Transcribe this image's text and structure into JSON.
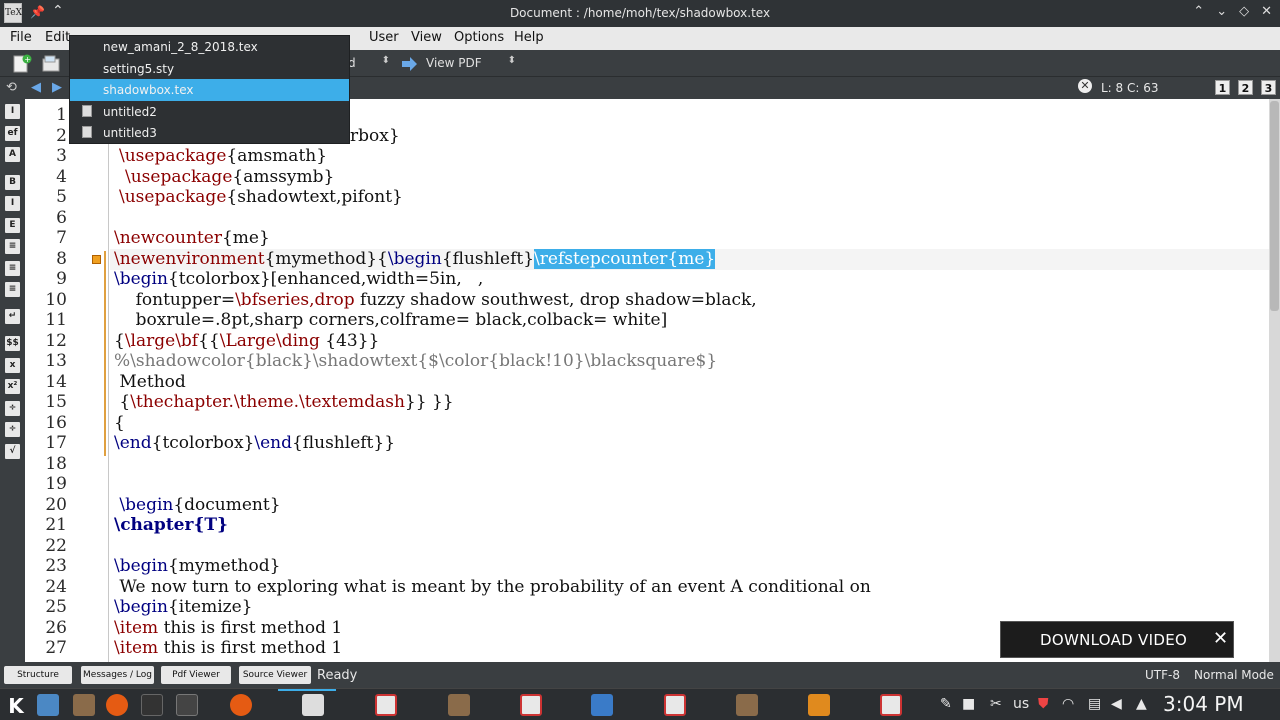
{
  "window": {
    "title": "Document : /home/moh/tex/shadowbox.tex",
    "app_icon": "TeX"
  },
  "menu": [
    "File",
    "Edit",
    "User",
    "View",
    "Options",
    "Help"
  ],
  "toolbar": {
    "combo1": "d",
    "combo2": "View PDF"
  },
  "editor_header": {
    "cursor": "L: 8 C: 63",
    "panes": [
      "1",
      "2",
      "3"
    ]
  },
  "dropdown": [
    "new_amani_2_8_2018.tex",
    "setting5.sty",
    "shadowbox.tex",
    "untitled2",
    "untitled3"
  ],
  "line_numbers": [
    "1",
    "2",
    "3",
    "4",
    "5",
    "6",
    "7",
    "8",
    "9",
    "10",
    "11",
    "12",
    "13",
    "14",
    "15",
    "16",
    "17",
    "18",
    "19",
    "20",
    "21",
    "22",
    "23",
    "24",
    "25",
    "26",
    "27"
  ],
  "code": {
    "l2": "rbox}",
    "l3a": "\\usepackage",
    "l3b": "{amsmath}",
    "l4a": "\\usepackage",
    "l4b": "{amssymb}",
    "l5a": "\\usepackage",
    "l5b": "{shadowtext,pifont}",
    "l7a": "\\newcounter",
    "l7b": "{me}",
    "l8a": "\\newenvironment",
    "l8b": "{mymethod}{",
    "l8c": "\\begin",
    "l8d": "{flushleft}",
    "l8e": "\\refstepcounter{me}",
    "l9a": "\\begin",
    "l9b": "{tcolorbox}[enhanced,width=5in,   ,",
    "l10a": "    fontupper=",
    "l10b": "\\bfseries,drop",
    "l10c": " fuzzy shadow southwest, drop shadow=black,",
    "l11": "    boxrule=.8pt,sharp corners,colframe= black,colback= white]",
    "l12a": "{",
    "l12b": "\\large\\bf",
    "l12c": "{{",
    "l12d": "\\Large\\ding",
    "l12e": " {43}}",
    "l13": "%\\shadowcolor{black}\\shadowtext{$\\color{black!10}\\blacksquare$}",
    "l14": " Method",
    "l15a": " {",
    "l15b": "\\thechapter.\\theme.\\textemdash",
    "l15c": "}} }}",
    "l16": "{",
    "l17a": "\\end",
    "l17b": "{tcolorbox}",
    "l17c": "\\end",
    "l17d": "{flushleft}}",
    "l20a": " \\begin",
    "l20b": "{document}",
    "l21": "\\chapter{T}",
    "l23a": "\\begin",
    "l23b": "{mymethod}",
    "l24": " We now turn to exploring what is meant by the probability of an event A conditional on",
    "l25a": "\\begin",
    "l25b": "{itemize}",
    "l26a": "\\item",
    "l26b": " this is first method 1",
    "l27a": "\\item",
    "l27b": " this is first method 1"
  },
  "status": {
    "tabs": [
      "Structure",
      "Messages / Log",
      "Pdf Viewer",
      "Source Viewer"
    ],
    "ready": "Ready",
    "encoding": "UTF-8",
    "mode": "Normal Mode"
  },
  "download_overlay": {
    "label": "DOWNLOAD VIDEO",
    "close": "✕"
  },
  "taskbar": {
    "keyboard_layout": "us",
    "clock": "3:04 PM"
  },
  "colors": {
    "accent": "#3daee9",
    "command": "#8b0000",
    "brace": "#000080"
  }
}
